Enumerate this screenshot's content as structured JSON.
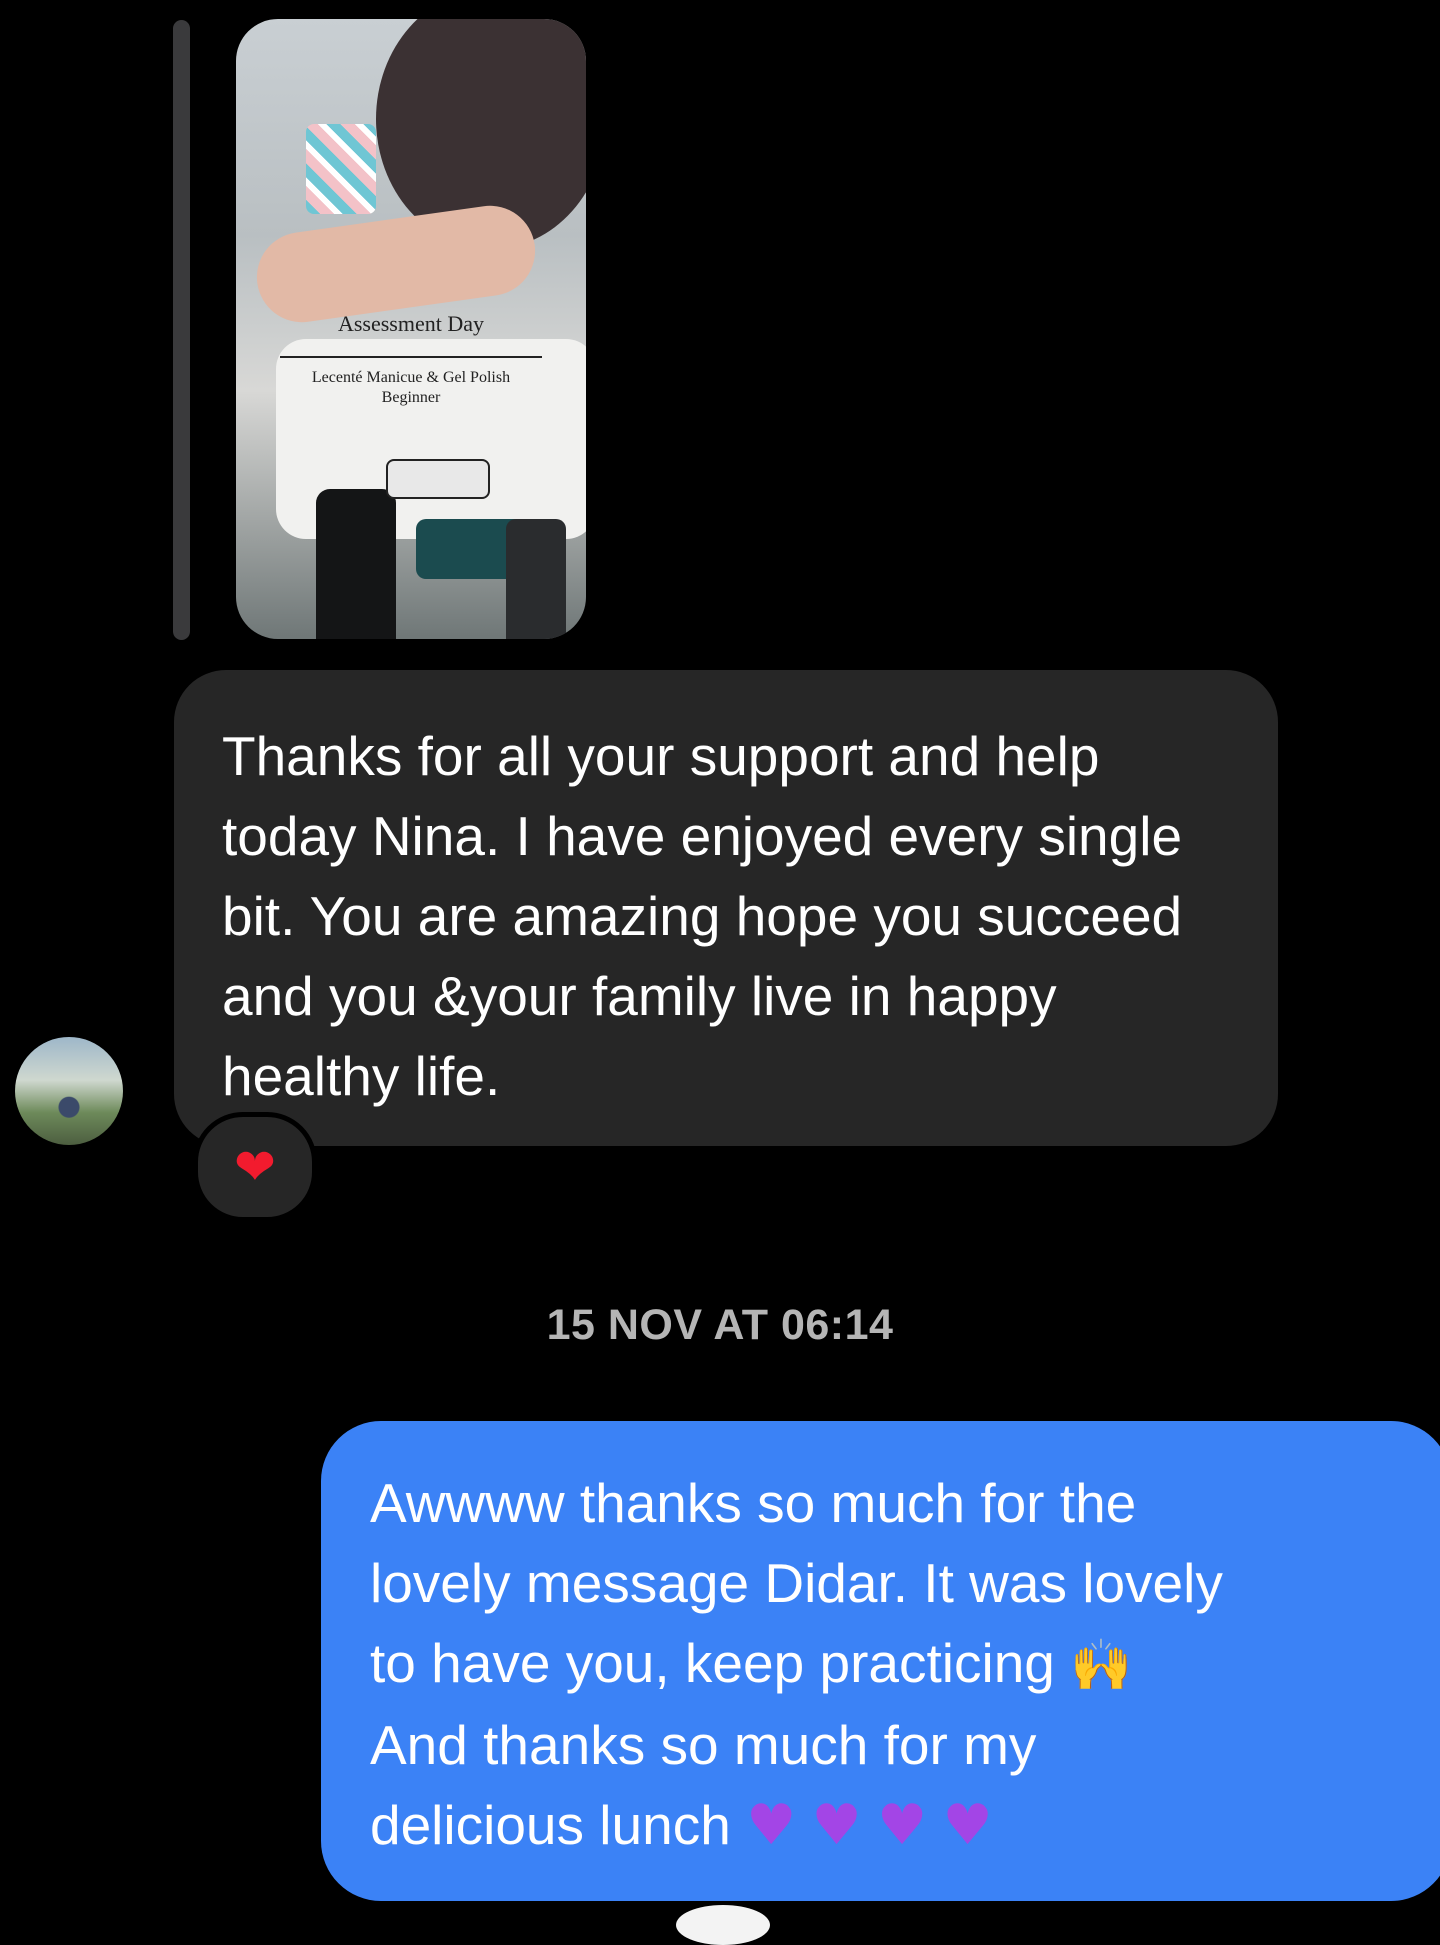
{
  "story_reply": {
    "title": "Assessment Day",
    "subtitle": "Lecenté Manicue & Gel Polish Beginner"
  },
  "incoming_message": {
    "text": "Thanks for all your support and help today Nina. I have enjoyed every single bit. You are amazing hope you succeed and you &your family live in happy healthy life.",
    "reaction": "❤"
  },
  "timestamp": "15 NOV AT 06:14",
  "outgoing_message": {
    "lines": [
      "Awwww thanks so much for the",
      "lovely message Didar. It was lovely",
      "to have you, keep practicing",
      "And thanks so much for my",
      "delicious lunch"
    ],
    "hands_emoji": "🙌",
    "heart_emoji": "♥"
  },
  "colors": {
    "incoming_bubble": "#262626",
    "outgoing_bubble": "#3b82f6",
    "timestamp": "#b5b5b5"
  }
}
